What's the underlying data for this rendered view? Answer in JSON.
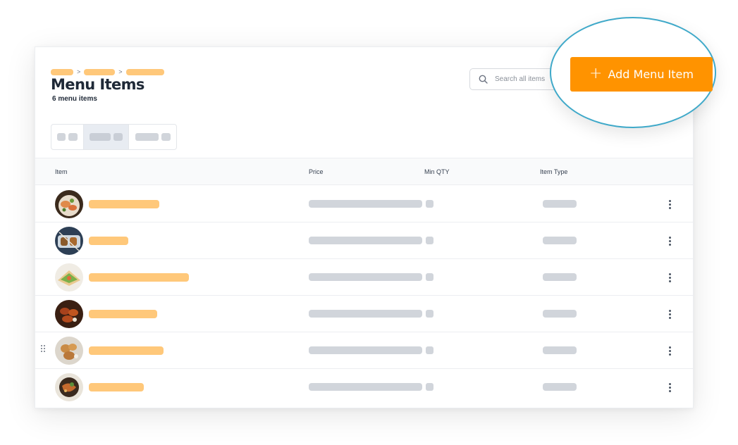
{
  "header": {
    "breadcrumb": {
      "separators": [
        ">",
        ">"
      ]
    },
    "title": "Menu Items",
    "subtitle": "6 menu items"
  },
  "search": {
    "placeholder": "Search all items",
    "icon": "search-icon"
  },
  "actions": {
    "add_label": "Add Menu Item",
    "add_icon": "plus-icon",
    "accent_color": "#ff9300",
    "highlight_color": "#3fa9c9"
  },
  "table": {
    "columns": [
      "Item",
      "Price",
      "Min QTY",
      "Item Type"
    ],
    "rows": [
      {
        "thumb": "shrimp-dish"
      },
      {
        "thumb": "grilled-skewers"
      },
      {
        "thumb": "sandwich"
      },
      {
        "thumb": "glazed-wings"
      },
      {
        "thumb": "fried-dumplings"
      },
      {
        "thumb": "noodle-bowl"
      }
    ]
  }
}
